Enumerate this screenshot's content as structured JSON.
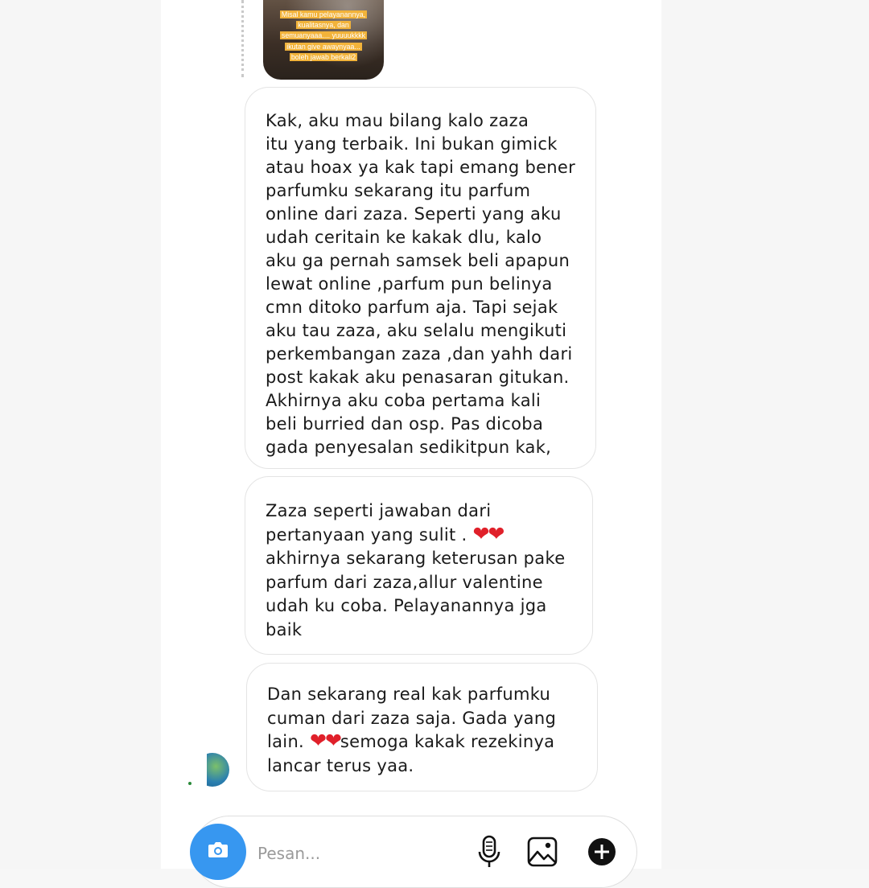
{
  "story_reply": {
    "text_lines": [
      "Misal kamu pelayanannya,",
      "kualitasnya, dan",
      "semuanyaaa.... yuuuukkkk",
      "ikutan give awaynyaa...",
      "boleh jawab berkali2"
    ]
  },
  "messages": [
    {
      "text": "Kak, aku mau bilang kalo zaza\nitu yang terbaik. Ini bukan gimick\natau hoax ya kak tapi emang bener\nparfumku sekarang itu parfum\nonline dari zaza. Seperti yang aku\nudah ceritain ke kakak dlu, kalo\naku ga pernah samsek beli apapun\nlewat online ,parfum pun belinya\ncmn ditoko parfum aja. Tapi sejak\naku tau zaza, aku selalu mengikuti\nperkembangan zaza ,dan yahh dari\npost kakak aku penasaran gitukan.\nAkhirnya aku coba pertama kali\nbeli burried dan osp. Pas dicoba\ngada penyesalan sedikitpun kak,"
    },
    {
      "line1": "Zaza seperti jawaban dari",
      "line2": "pertanyaan yang sulit . ",
      "emoji": "❤❤",
      "rest": "akhirnya sekarang keterusan pake\nparfum dari zaza,allur valentine\nudah ku coba. Pelayanannya jga\nbaik"
    },
    {
      "line1": "Dan sekarang real kak parfumku",
      "line2": "cuman dari zaza saja. Gada yang",
      "line3_pre": "lain. ",
      "emoji": "❤❤",
      "line3_post": "semoga kakak rezekinya",
      "line4": "lancar terus yaa."
    }
  ],
  "composer": {
    "placeholder": "Pesan...",
    "icons": [
      "camera-icon",
      "microphone-icon",
      "image-icon",
      "plus-icon"
    ]
  },
  "colors": {
    "accent_blue": "#3797f0",
    "heart_red": "#e0202a",
    "story_highlight": "#f2b33a"
  }
}
